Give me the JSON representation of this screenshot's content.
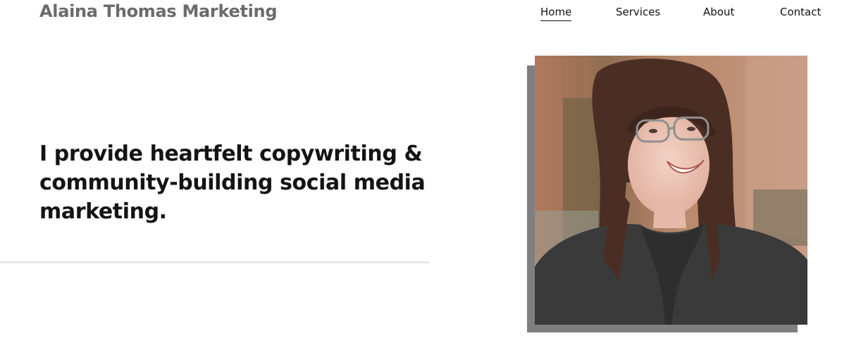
{
  "header": {
    "brand": "Alaina Thomas Marketing",
    "nav": [
      {
        "label": "Home",
        "active": true
      },
      {
        "label": "Services",
        "active": false
      },
      {
        "label": "About",
        "active": false
      },
      {
        "label": "Contact",
        "active": false
      }
    ]
  },
  "hero": {
    "headline": "I provide heartfelt copywriting & community-building social media marketing."
  },
  "colors": {
    "brand_text": "#6b6b6b",
    "headline_text": "#141414",
    "photo_shadow": "#7f7f7f",
    "divider": "#e9e9e9"
  }
}
